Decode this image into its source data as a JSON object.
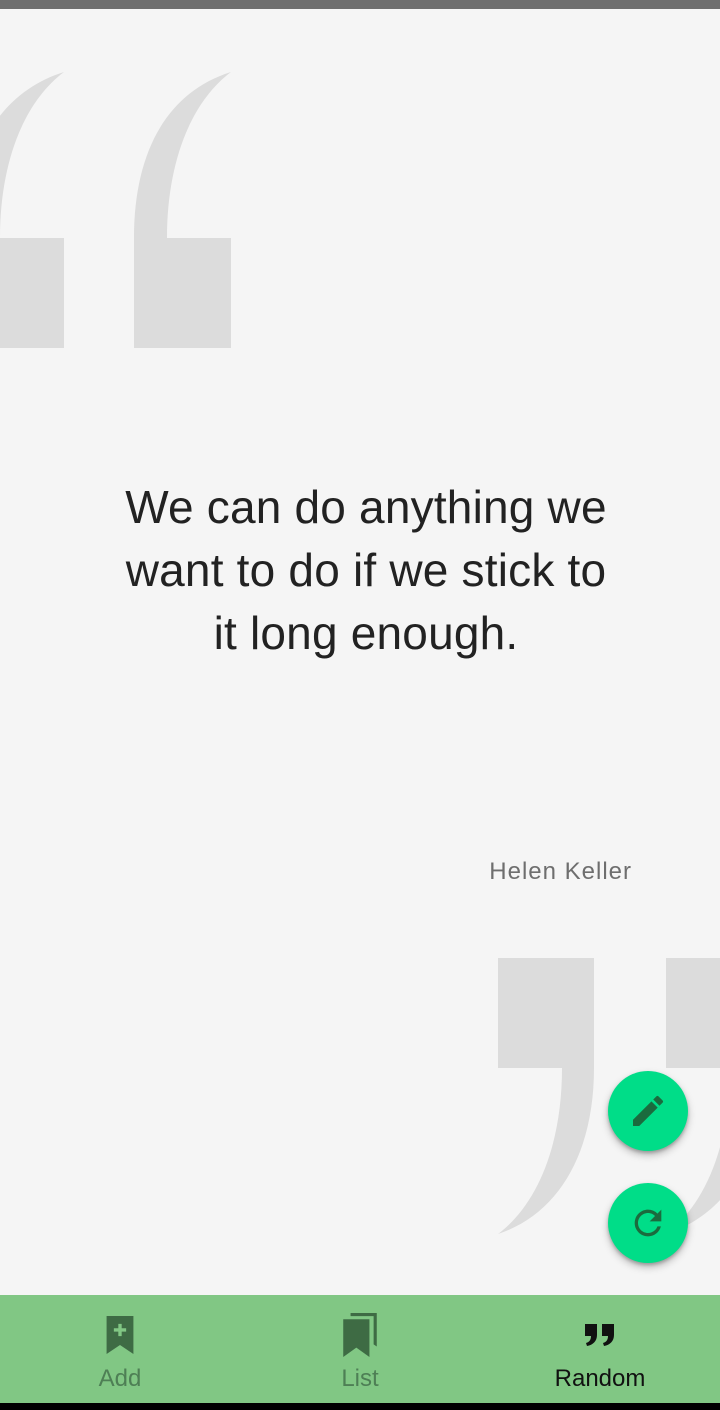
{
  "colors": {
    "background": "#f5f5f5",
    "deco_quote": "#dcdcdc",
    "quote_text": "#222222",
    "author_text": "#6e6e6e",
    "fab": "#00dd88",
    "fab_icon": "#1b6b3e",
    "nav_background": "#81c784",
    "nav_active": "#111111",
    "nav_inactive_label": "#4e7f55",
    "nav_inactive_icon": "#3e6b44"
  },
  "quote": {
    "text": "We can do anything we want to do if we stick to it long enough.",
    "author": "Helen Keller"
  },
  "fabs": {
    "edit_icon": "pencil-icon",
    "refresh_icon": "refresh-icon"
  },
  "nav": {
    "items": [
      {
        "label": "Add",
        "icon": "bookmark-add-icon",
        "active": false
      },
      {
        "label": "List",
        "icon": "bookmarks-icon",
        "active": false
      },
      {
        "label": "Random",
        "icon": "quote-icon",
        "active": true
      }
    ]
  }
}
